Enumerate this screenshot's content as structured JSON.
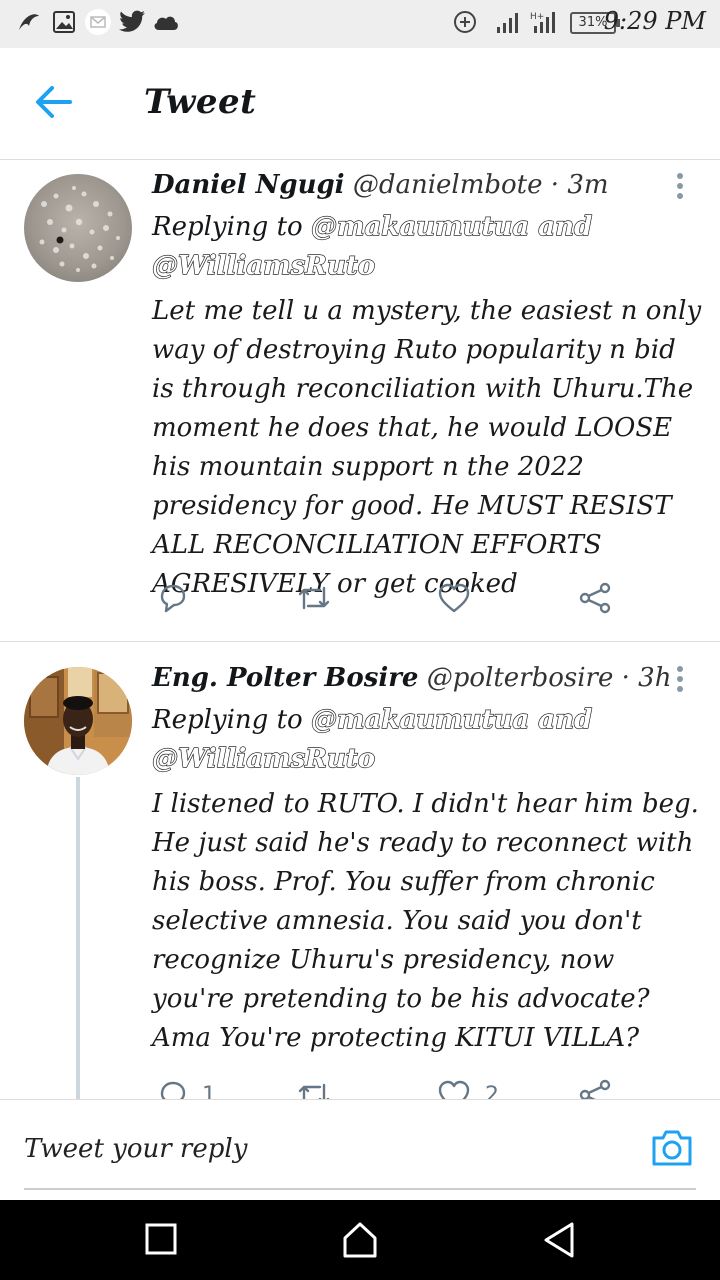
{
  "status_bar": {
    "time": "9:29 PM",
    "battery": "31%"
  },
  "header": {
    "title": "Tweet"
  },
  "tweets": [
    {
      "name": "Daniel Ngugi",
      "handle": "@danielmbote",
      "dot": "·",
      "time": "3m",
      "replying_prefix": "Replying to",
      "replying_mentions": "@makaumutua and",
      "replying_mentions2": "@WilliamsRuto",
      "body": "Let me tell u a mystery, the easiest n only way of destroying Ruto popularity n bid is through reconciliation with Uhuru.The moment he does that, he would LOOSE his mountain support n the 2022 presidency for good. He MUST RESIST ALL RECONCILIATION EFFORTS AGRESIVELY or get cooked"
    },
    {
      "name": "Eng. Polter Bosire",
      "handle": "@polterbosire",
      "dot": "·",
      "time": "3h",
      "replying_prefix": "Replying to",
      "replying_mentions": "@makaumutua and",
      "replying_mentions2": "@WilliamsRuto",
      "body": "I listened to RUTO. I didn't hear him beg. He just said he's ready to reconnect with his boss. Prof. You suffer from chronic selective amnesia. You said you don't recognize Uhuru's presidency, now you're pretending to be his advocate? Ama You're protecting KITUI VILLA?",
      "reply_count": "1",
      "like_count": "2"
    }
  ],
  "composer": {
    "placeholder": "Tweet your reply"
  },
  "colors": {
    "accent": "#1da1f2",
    "icon_gray": "#657786",
    "divider": "#dddddd"
  }
}
